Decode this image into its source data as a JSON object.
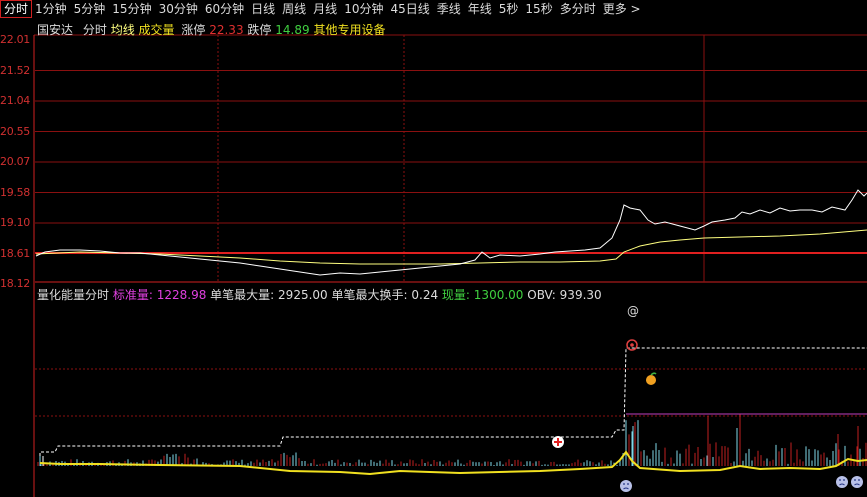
{
  "tabs": [
    "分时",
    "1分钟",
    "5分钟",
    "15分钟",
    "30分钟",
    "60分钟",
    "日线",
    "周线",
    "月线",
    "10分钟",
    "45日线",
    "季线",
    "年线",
    "5秒",
    "15秒",
    "多分时",
    "更多 >"
  ],
  "active_tab": 0,
  "price_header": {
    "stock_name": "国安达",
    "mode": "分时",
    "avg_line": "均线",
    "volume": "成交量",
    "limit_up_label": "涨停",
    "limit_up_value": "22.33",
    "limit_down_label": "跌停",
    "limit_down_value": "14.89",
    "sector": "其他专用设备"
  },
  "price_axis": [
    "22.01",
    "21.52",
    "21.04",
    "20.55",
    "20.07",
    "19.58",
    "19.10",
    "18.61",
    "18.12"
  ],
  "indicator_header": {
    "name": "量化能量分时",
    "std_label": "标准量:",
    "std_value": "1228.98",
    "max_vol_label": "单笔最大量:",
    "max_vol_value": "2925.00",
    "max_turn_label": "单笔最大换手:",
    "max_turn_value": "0.24",
    "cur_label": "现量:",
    "cur_value": "1300.00",
    "obv_label": "OBV:",
    "obv_value": "939.30"
  },
  "markers": {
    "at_symbol": "@",
    "plus_symbol": "+"
  },
  "colors": {
    "red_axis": "#d02020",
    "grid": "#8a1010",
    "price_line": "#ffffff",
    "avg_line": "#ffff80",
    "magenta": "#e040e0",
    "green": "#40d040",
    "yellow": "#f0e020"
  }
}
